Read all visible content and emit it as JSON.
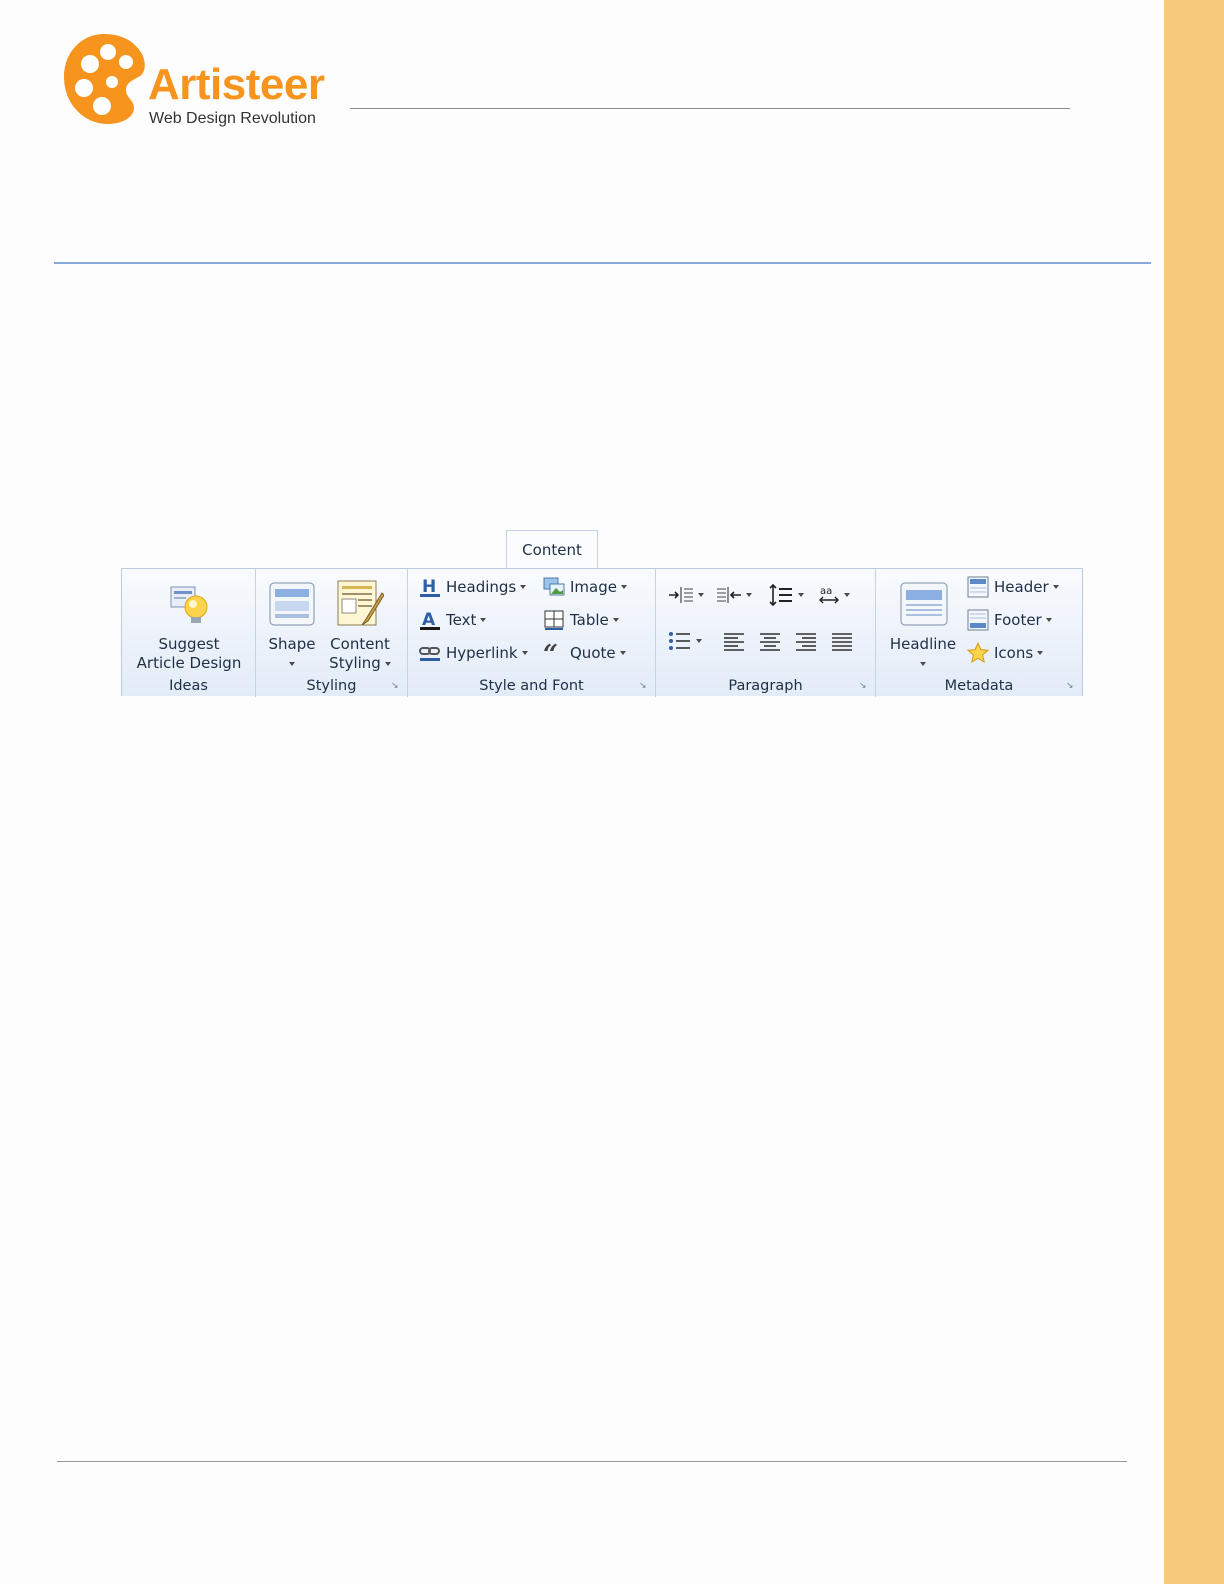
{
  "logo": {
    "title": "Artisteer",
    "tagline": "Web Design Revolution",
    "brand_color": "#f7941d"
  },
  "side_band_color": "#f7cb7b",
  "ribbon": {
    "active_tab": "Content",
    "groups": {
      "ideas": {
        "button_line1": "Suggest",
        "button_line2": "Article Design",
        "label": "Ideas",
        "icon": "lightbulb-icon"
      },
      "styling": {
        "shape_label": "Shape",
        "content_styling_line1": "Content",
        "content_styling_line2": "Styling",
        "label": "Styling"
      },
      "style_font": {
        "headings": "Headings",
        "text": "Text",
        "hyperlink": "Hyperlink",
        "image": "Image",
        "table": "Table",
        "quote": "Quote",
        "label": "Style and Font"
      },
      "paragraph": {
        "label": "Paragraph",
        "buttons": [
          "increase-indent-icon",
          "decrease-indent-icon",
          "line-spacing-icon",
          "character-spacing-icon",
          "bullet-list-icon",
          "align-left-icon",
          "align-center-icon",
          "align-right-icon",
          "justify-icon"
        ]
      },
      "metadata": {
        "headline": "Headline",
        "header": "Header",
        "footer": "Footer",
        "icons": "Icons",
        "label": "Metadata"
      }
    }
  }
}
